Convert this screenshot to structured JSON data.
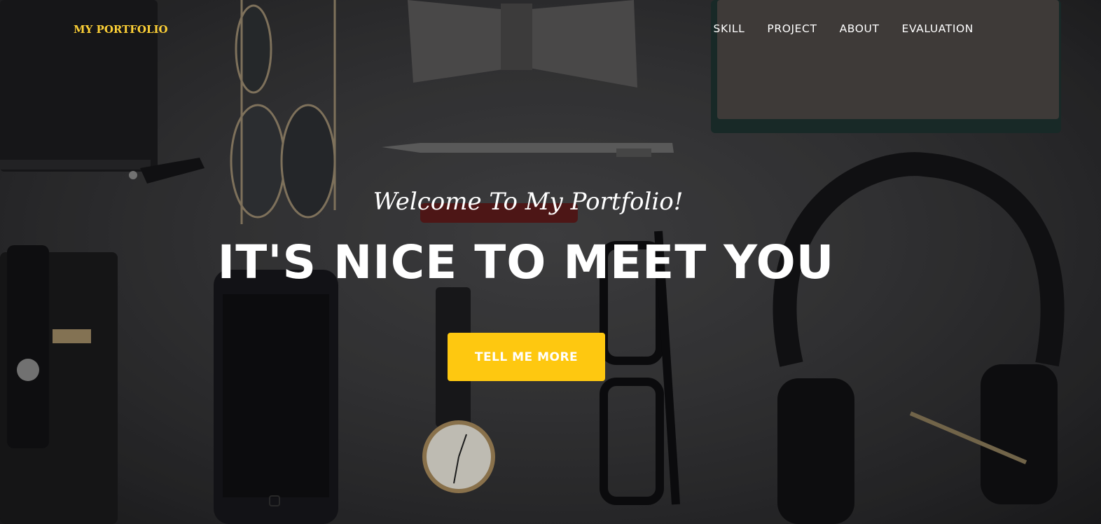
{
  "navbar": {
    "brand": "MY PORTFOLIO",
    "links": [
      "SKILL",
      "PROJECT",
      "ABOUT",
      "EVALUATION"
    ]
  },
  "hero": {
    "lead_in": "Welcome To My Portfolio!",
    "heading": "IT'S NICE TO MEET YOU",
    "button_label": "TELL ME MORE"
  },
  "colors": {
    "accent": "#fed136",
    "button": "#fec810",
    "text": "#ffffff",
    "background": "#2b2b2d"
  }
}
